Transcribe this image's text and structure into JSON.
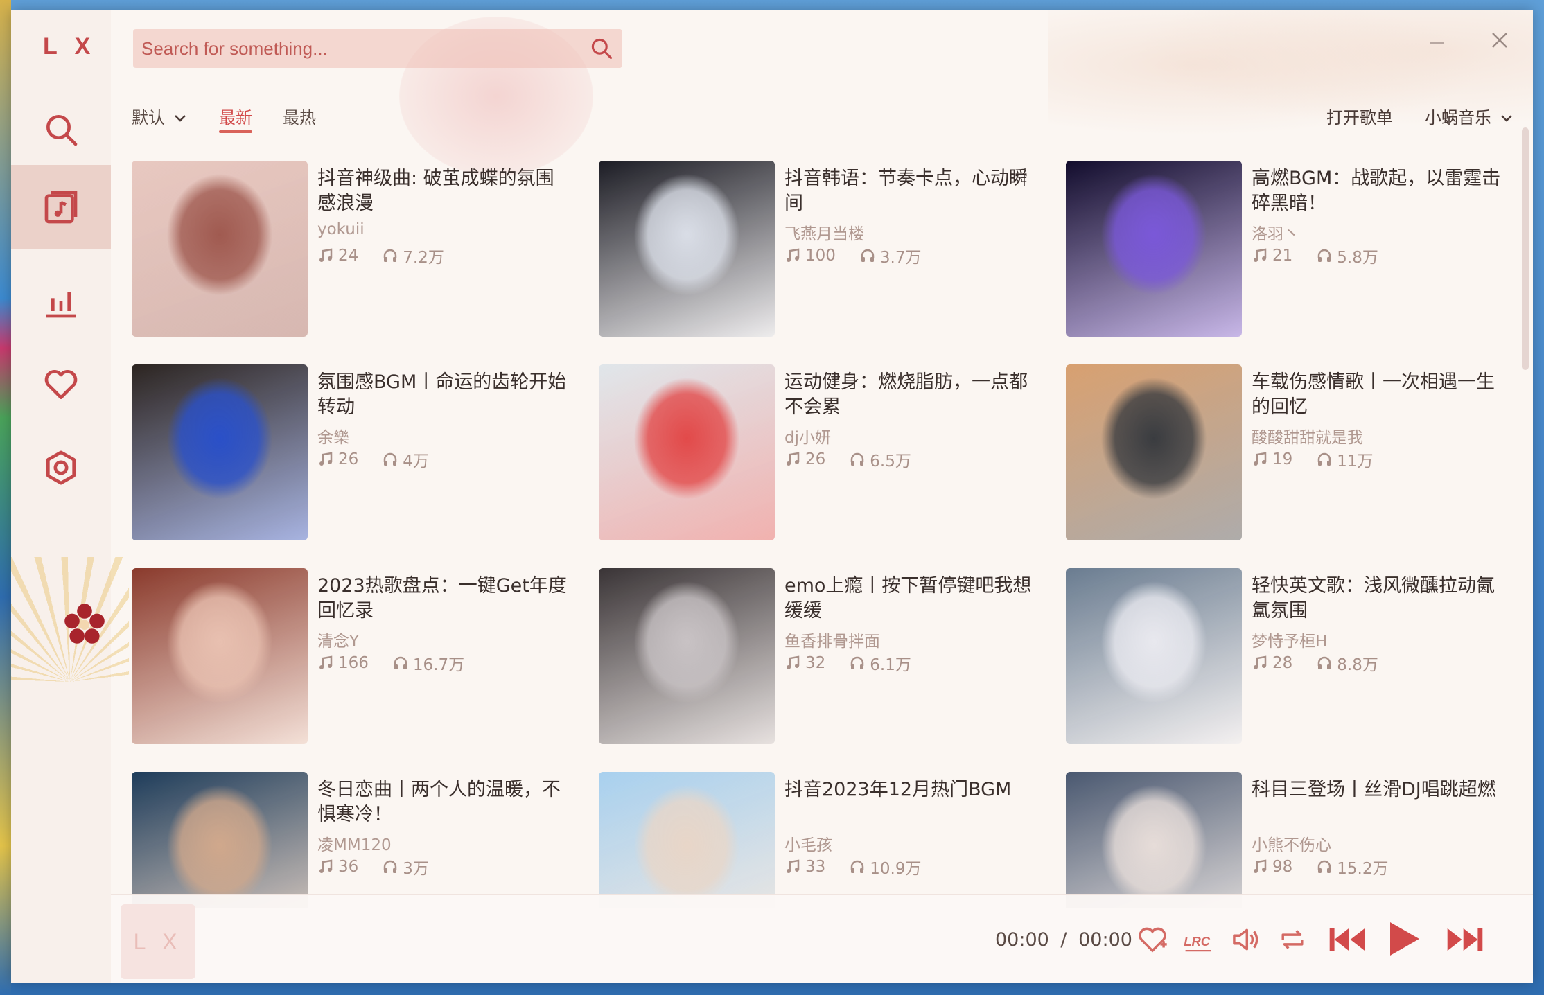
{
  "app": {
    "logo": "L X"
  },
  "search": {
    "placeholder": "Search for something..."
  },
  "tabs": [
    {
      "label": "默认"
    },
    {
      "label": "最新"
    },
    {
      "label": "最热"
    }
  ],
  "header_links": {
    "open_playlist": "打开歌单",
    "source": "小蜗音乐"
  },
  "playlists": [
    {
      "title": "抖音神级曲: 破茧成蝶的氛围感浪漫",
      "author": "yokuii",
      "songs": "24",
      "plays": "7.2万",
      "cover_colors": [
        "#e8c8c0",
        "#a05a50"
      ]
    },
    {
      "title": "抖音韩语：节奏卡点，心动瞬间",
      "author": "飞燕月当楼",
      "songs": "100",
      "plays": "3.7万",
      "cover_colors": [
        "#1c1c24",
        "#d9dde6"
      ]
    },
    {
      "title": "高燃BGM：战歌起，以雷霆击碎黑暗！",
      "author": "洛羽丶",
      "songs": "21",
      "plays": "5.8万",
      "cover_colors": [
        "#120c2c",
        "#7a58d8"
      ]
    },
    {
      "title": "氛围感BGM丨命运的齿轮开始转动",
      "author": "余樂",
      "songs": "26",
      "plays": "4万",
      "cover_colors": [
        "#2c2420",
        "#2a50c8"
      ]
    },
    {
      "title": "运动健身：燃烧脂肪，一点都不会累",
      "author": "dj小妍",
      "songs": "26",
      "plays": "6.5万",
      "cover_colors": [
        "#e0e6ea",
        "#e24a4a"
      ]
    },
    {
      "title": "车载伤感情歌丨一次相遇一生的回忆",
      "author": "酸酸甜甜就是我",
      "songs": "19",
      "plays": "11万",
      "cover_colors": [
        "#d8a070",
        "#3a3c40"
      ]
    },
    {
      "title": "2023热歌盘点：一键Get年度回忆录",
      "author": "清念Y",
      "songs": "166",
      "plays": "16.7万",
      "cover_colors": [
        "#8a3a2c",
        "#e8c0b0"
      ]
    },
    {
      "title": "emo上瘾丨按下暂停键吧我想缓缓",
      "author": "鱼香排骨拌面",
      "songs": "32",
      "plays": "6.1万",
      "cover_colors": [
        "#3a3436",
        "#c8c2c4"
      ]
    },
    {
      "title": "轻快英文歌：浅风微醺拉动氤氲氛围",
      "author": "梦恃予桓H",
      "songs": "28",
      "plays": "8.8万",
      "cover_colors": [
        "#6a7c90",
        "#e8e8ee"
      ]
    },
    {
      "title": "冬日恋曲丨两个人的温暖，不惧寒冷！",
      "author": "凌MM120",
      "songs": "36",
      "plays": "3万",
      "cover_colors": [
        "#1e3c5a",
        "#d0a88c"
      ]
    },
    {
      "title": "抖音2023年12月热门BGM",
      "author": "小毛孩",
      "songs": "33",
      "plays": "10.9万",
      "cover_colors": [
        "#a8d0ee",
        "#e8d6c8"
      ]
    },
    {
      "title": "科目三登场丨丝滑DJ唱跳超燃",
      "author": "小熊不伤心",
      "songs": "98",
      "plays": "15.2万",
      "cover_colors": [
        "#4a5870",
        "#e6dcd8"
      ]
    }
  ],
  "player": {
    "cover_text": "L X",
    "time_current": "00:00",
    "time_separator": "/",
    "time_total": "00:00"
  },
  "colors": {
    "accent": "#d24a4a",
    "sidebar_icon": "#c4484a",
    "player_icon": "#d24a4a"
  }
}
